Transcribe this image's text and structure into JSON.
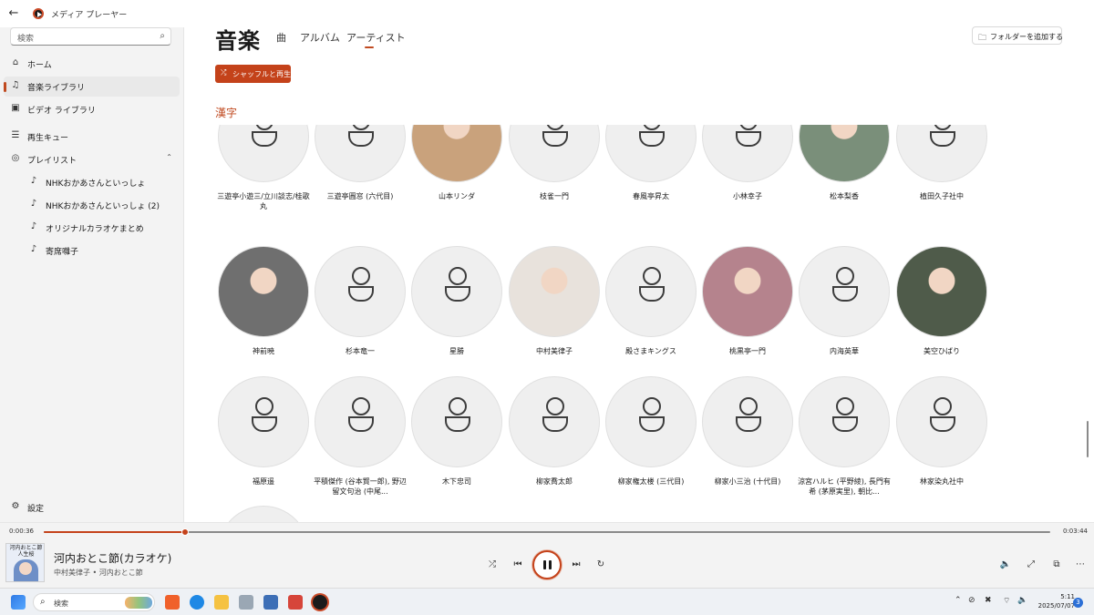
{
  "window": {
    "title": "メディア プレーヤー",
    "controls": [
      "—",
      "❐",
      "✕"
    ]
  },
  "sidebar": {
    "search_placeholder": "検索",
    "items": [
      {
        "label": "ホーム",
        "icon": "home-icon"
      },
      {
        "label": "音楽ライブラリ",
        "icon": "music-note-icon",
        "active": true
      },
      {
        "label": "ビデオ ライブラリ",
        "icon": "video-icon"
      },
      {
        "label": "再生キュー",
        "icon": "queue-icon"
      },
      {
        "label": "プレイリスト",
        "icon": "playlist-icon",
        "expanded": true
      }
    ],
    "playlists": [
      "NHKおかあさんといっしょ",
      "NHKおかあさんといっしょ (2)",
      "オリジナルカラオケまとめ",
      "寄席囃子"
    ],
    "settings_label": "設定"
  },
  "main": {
    "title": "音楽",
    "tabs": [
      {
        "label": "曲"
      },
      {
        "label": "アルバム"
      },
      {
        "label": "アーティスト",
        "selected": true
      }
    ],
    "add_folder_label": "フォルダーを追加する",
    "shuffle_label": "シャッフルと再生",
    "section_heading": "漢字",
    "artists": [
      {
        "name": "三遊亭小遊三/立川談志/桂歌丸",
        "photo": false
      },
      {
        "name": "三遊亭圓窓 (六代目)",
        "photo": false
      },
      {
        "name": "山本リンダ",
        "photo": true,
        "tint": "#c9a27c"
      },
      {
        "name": "枝雀一門",
        "photo": false
      },
      {
        "name": "春風亭昇太",
        "photo": false
      },
      {
        "name": "小林幸子",
        "photo": false
      },
      {
        "name": "松本梨香",
        "photo": true,
        "tint": "#7a8f7a"
      },
      {
        "name": "植田久子社中",
        "photo": false
      },
      {
        "name": "神前暁",
        "photo": true,
        "tint": "#6f6f6f"
      },
      {
        "name": "杉本竜一",
        "photo": false
      },
      {
        "name": "星勝",
        "photo": false
      },
      {
        "name": "中村美律子",
        "photo": true,
        "tint": "#e8e2dc"
      },
      {
        "name": "殿さまキングス",
        "photo": false
      },
      {
        "name": "桃黒亭一門",
        "photo": true,
        "tint": "#b5838d"
      },
      {
        "name": "内海英華",
        "photo": false
      },
      {
        "name": "美空ひばり",
        "photo": true,
        "tint": "#4f5b4a"
      },
      {
        "name": "福原遥",
        "photo": false
      },
      {
        "name": "平積傑作 (谷本賢一郎), 野辺留文句治 (中尾...",
        "photo": false
      },
      {
        "name": "木下忠司",
        "photo": false
      },
      {
        "name": "柳家喬太郎",
        "photo": false
      },
      {
        "name": "柳家権太楼 (三代目)",
        "photo": false
      },
      {
        "name": "柳家小三治 (十代目)",
        "photo": false
      },
      {
        "name": "涼宮ハルヒ (平野綾), 長門有希 (茅原実里), 朝比...",
        "photo": false
      },
      {
        "name": "林家染丸社中",
        "photo": false
      },
      {
        "name": "",
        "photo": false
      }
    ]
  },
  "player": {
    "elapsed": "0:00:36",
    "duration": "0:03:44",
    "progress": 0.14,
    "album_caption": "河内おとこ節 人生桜",
    "track_title": "河内おとこ節(カラオケ)",
    "track_subtitle": "中村美律子 • 河内おとこ節",
    "state": "playing",
    "accent": "#c4421a"
  },
  "taskbar": {
    "search_label": "検索",
    "time": "5:11",
    "date": "2025/07/07",
    "notification_count": "3"
  }
}
